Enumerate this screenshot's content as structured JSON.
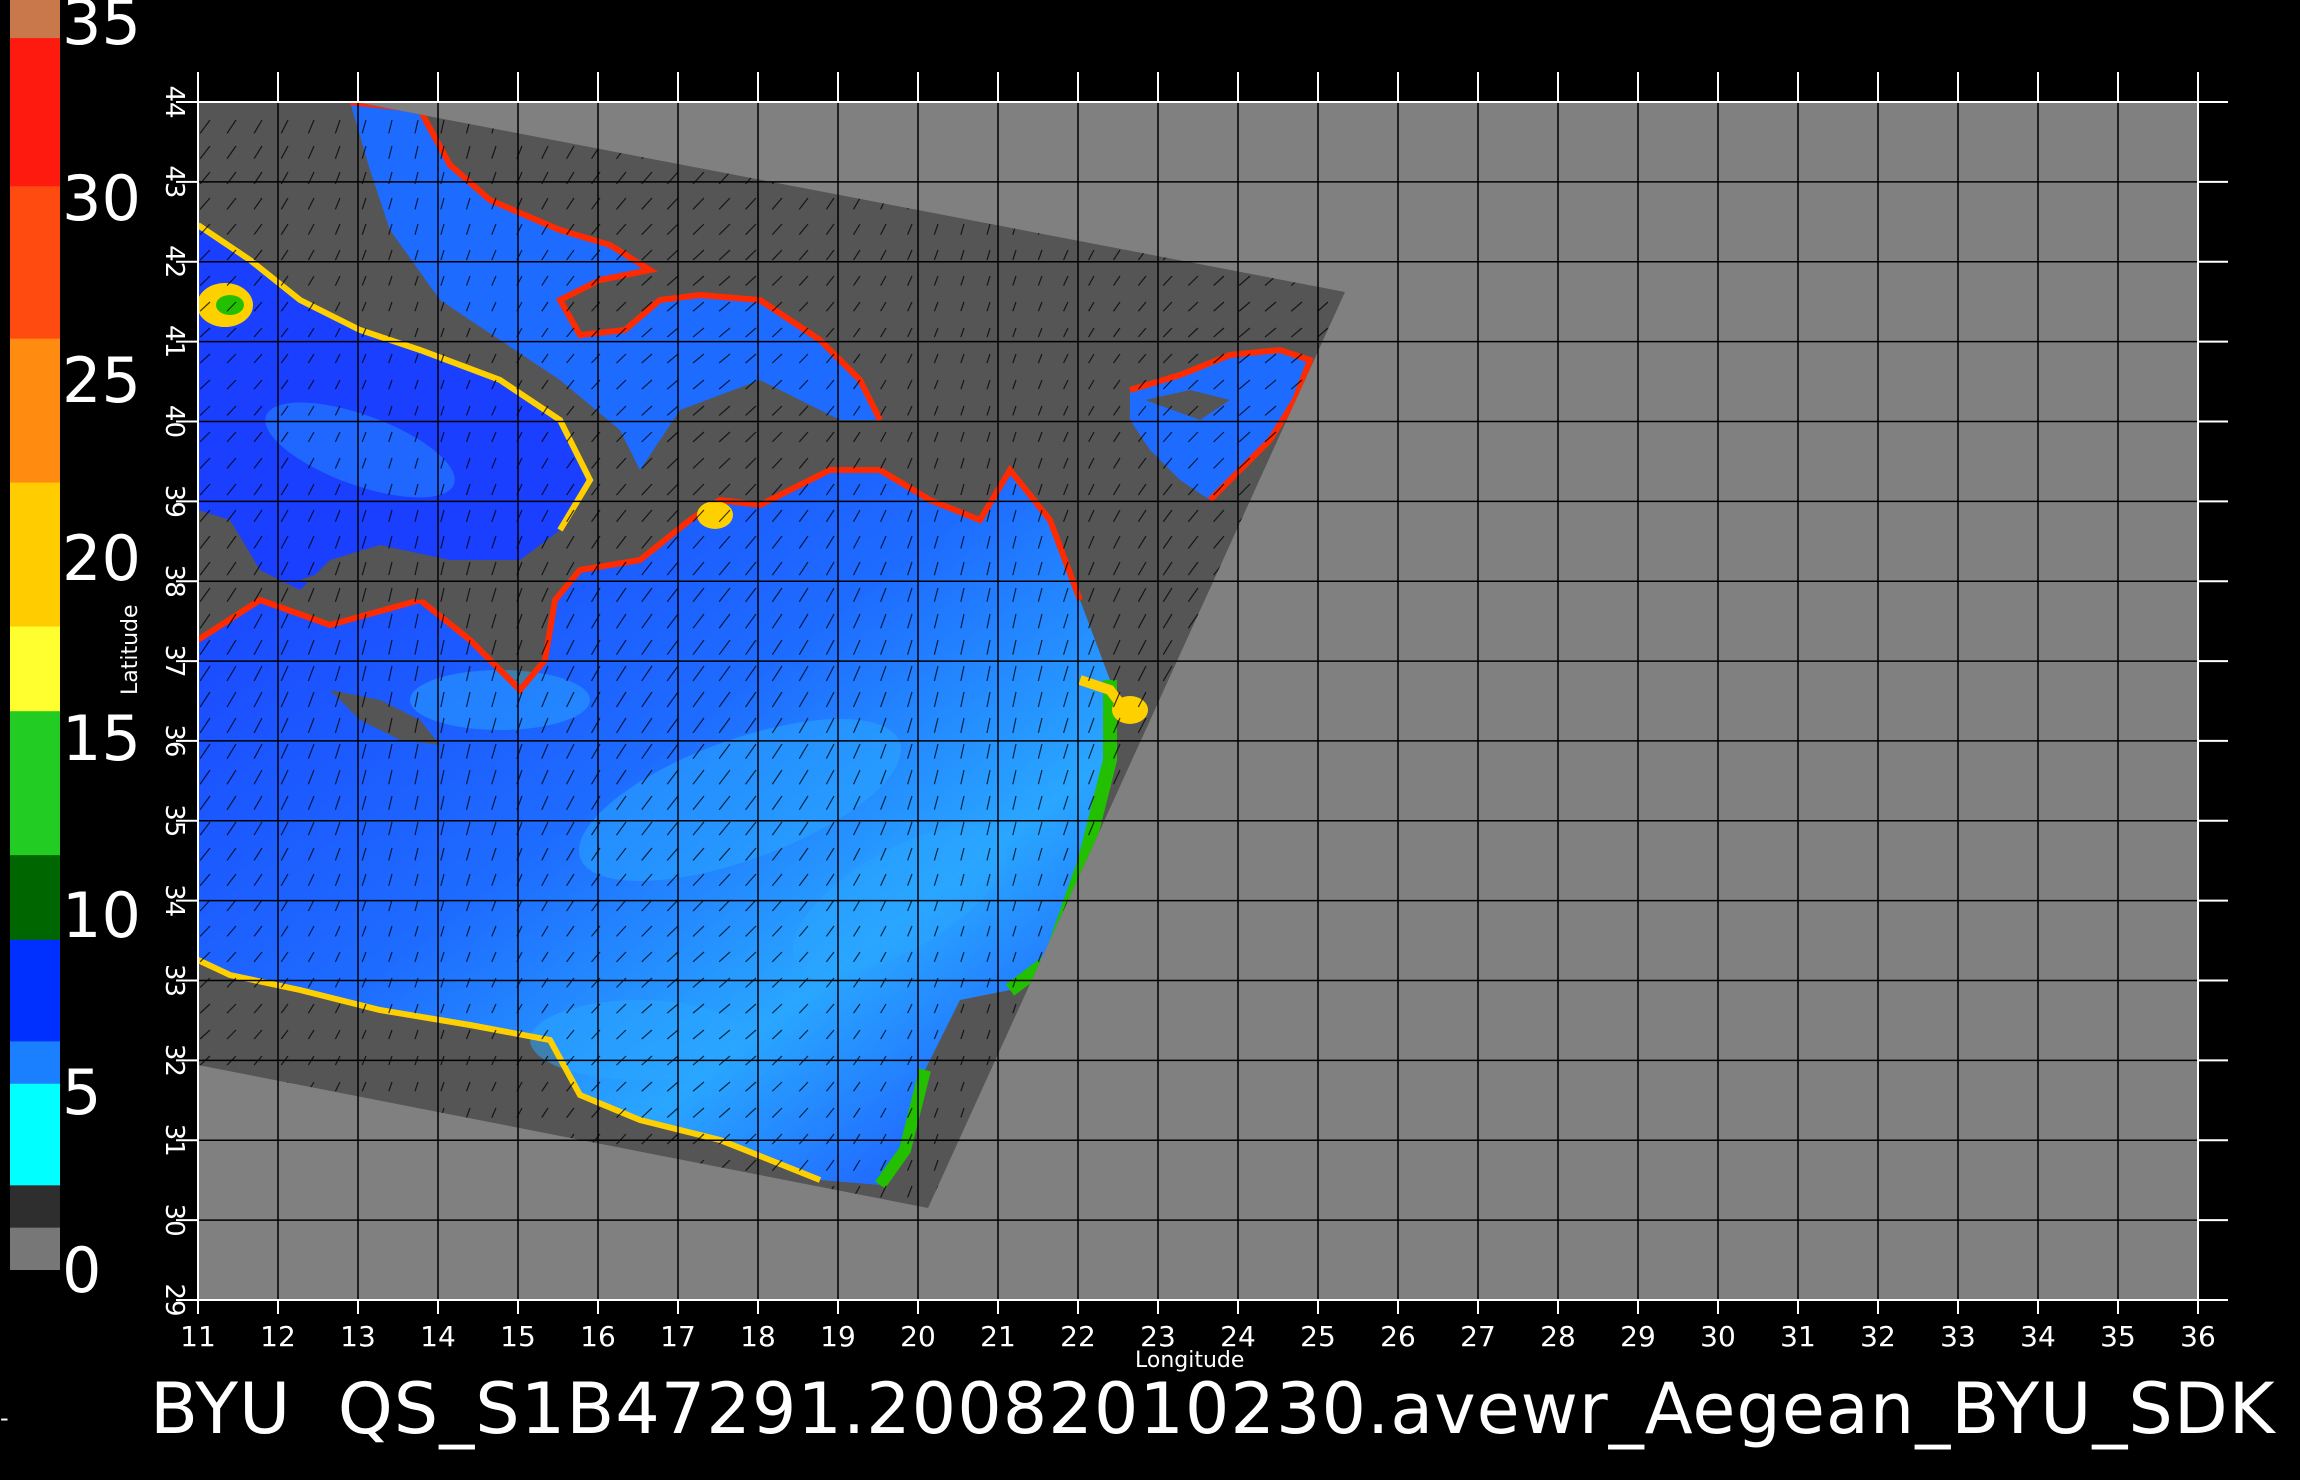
{
  "colorbar": {
    "labels": [
      "35",
      "30",
      "25",
      "20",
      "15",
      "10",
      "5",
      "0"
    ],
    "segments": [
      {
        "color": "#c8784a"
      },
      {
        "color": "#ff1a10"
      },
      {
        "color": "#ff4a10"
      },
      {
        "color": "#ff8c10"
      },
      {
        "color": "#ffcc00"
      },
      {
        "color": "#ffff30"
      },
      {
        "color": "#22cc22"
      },
      {
        "color": "#006600"
      },
      {
        "color": "#0030ff"
      },
      {
        "color": "#1a80ff"
      },
      {
        "color": "#00ffff"
      },
      {
        "color": "#2e2e2e"
      },
      {
        "color": "#777777"
      }
    ]
  },
  "axes": {
    "x_label": "Longitude",
    "y_label": "Latitude",
    "x_ticks": [
      "11",
      "12",
      "13",
      "14",
      "15",
      "16",
      "17",
      "18",
      "19",
      "20",
      "21",
      "22",
      "23",
      "24",
      "25",
      "26",
      "27",
      "28",
      "29",
      "30",
      "31",
      "32",
      "33",
      "34",
      "35",
      "36"
    ],
    "y_ticks": [
      "29",
      "30",
      "31",
      "32",
      "33",
      "34",
      "35",
      "36",
      "37",
      "38",
      "39",
      "40",
      "41",
      "42",
      "43",
      "44"
    ]
  },
  "map": {
    "background_color": "#808080",
    "swath_color": "#555555",
    "grid_color": "#000000",
    "ocean_colors": [
      "#1a3fff",
      "#1e6cff",
      "#29a6ff",
      "#00e0ff"
    ],
    "coast_colors": [
      "#ff2a00",
      "#ffd000",
      "#22c000",
      "#b030ff"
    ],
    "swath_land_color": "#555555"
  },
  "caption": "BYU  QS_S1B47291.20082010230.avewr_Aegean_BYU_SDK",
  "side_marker": "-"
}
